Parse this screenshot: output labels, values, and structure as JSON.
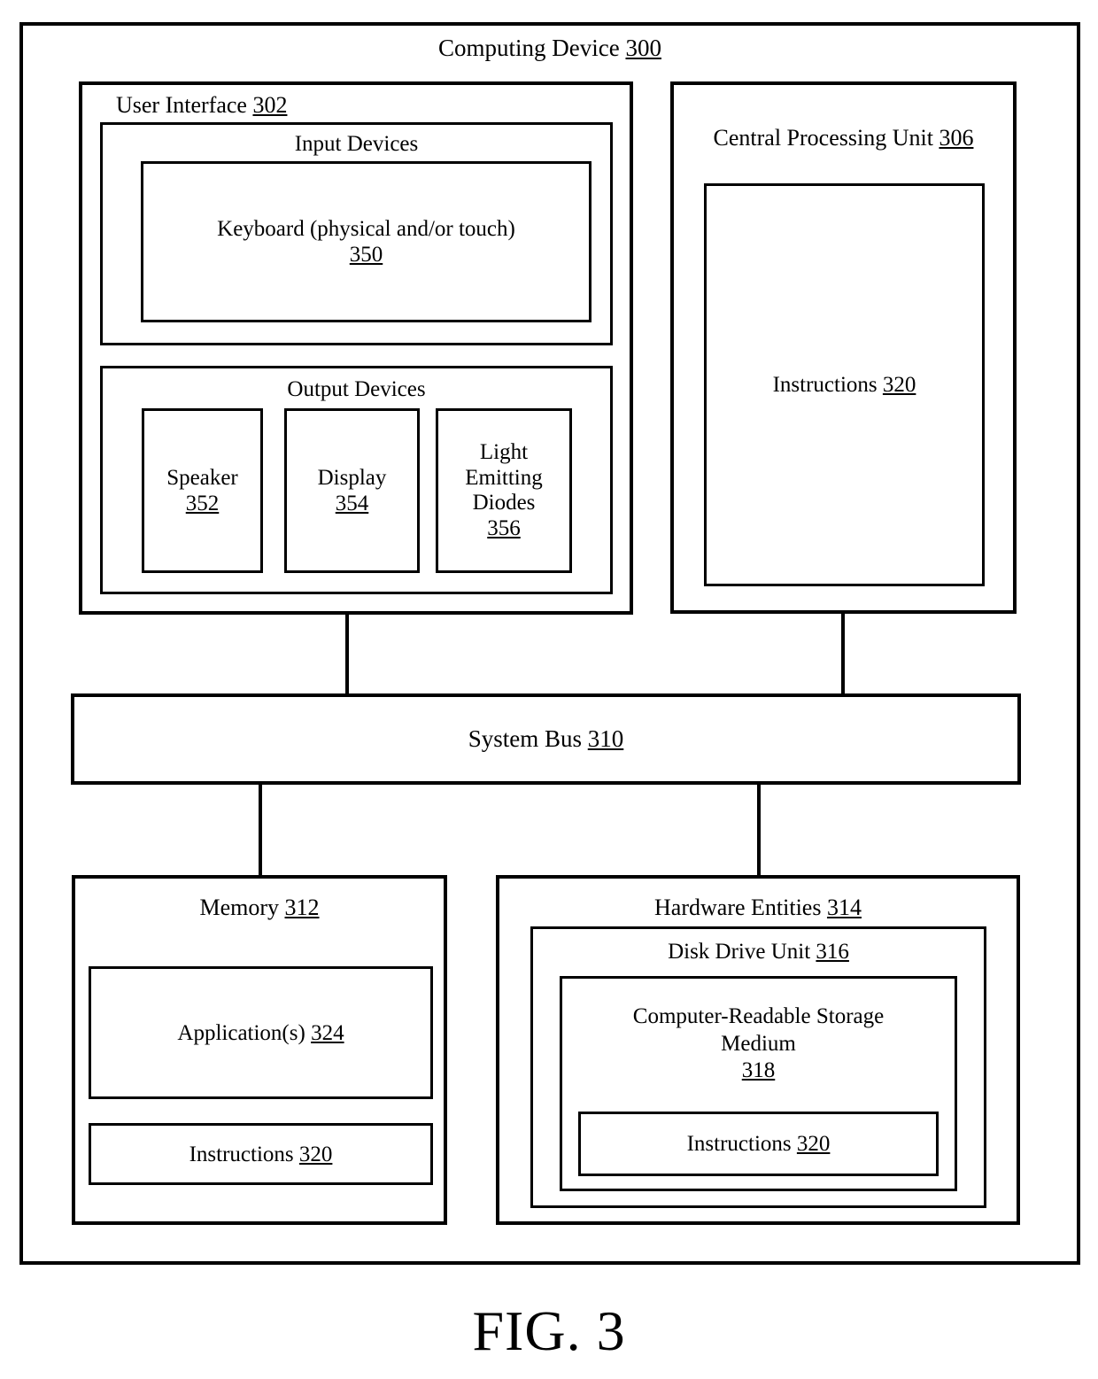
{
  "figure": {
    "caption": "FIG. 3"
  },
  "diagram": {
    "outer": {
      "label": "Computing Device",
      "number": "300"
    },
    "user_interface": {
      "label": "User Interface",
      "number": "302",
      "input_devices": {
        "label": "Input Devices",
        "number": "",
        "items": [
          {
            "label": "Keyboard (physical and/or touch)",
            "number": "350"
          }
        ]
      },
      "output_devices": {
        "label": "Output Devices",
        "number": "",
        "items": [
          {
            "label": "Speaker",
            "number": "352"
          },
          {
            "label": "Display",
            "number": "354"
          },
          {
            "label": "Light Emitting Diodes",
            "number": "356"
          }
        ]
      }
    },
    "cpu": {
      "label": "Central Processing Unit",
      "number": "306",
      "instructions": {
        "label": "Instructions",
        "number": "320"
      }
    },
    "system_bus": {
      "label": "System Bus",
      "number": "310"
    },
    "memory": {
      "label": "Memory",
      "number": "312",
      "applications": {
        "label": "Application(s)",
        "number": "324"
      },
      "instructions": {
        "label": "Instructions",
        "number": "320"
      }
    },
    "hardware_entities": {
      "label": "Hardware Entities",
      "number": "314",
      "disk_drive_unit": {
        "label": "Disk Drive Unit",
        "number": "316",
        "storage_medium": {
          "label_line1": "Computer-Readable Storage",
          "label_line2": "Medium",
          "number": "318",
          "instructions": {
            "label": "Instructions",
            "number": "320"
          }
        }
      }
    }
  },
  "style": {
    "line_color": "#000000",
    "background": "#ffffff"
  }
}
